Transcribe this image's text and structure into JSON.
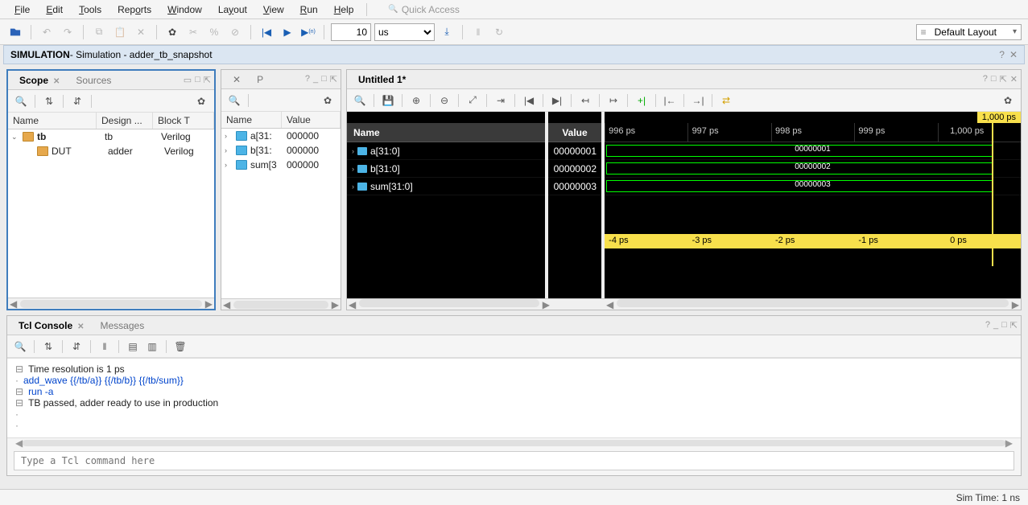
{
  "menu": {
    "items": [
      "File",
      "Edit",
      "Tools",
      "Reports",
      "Window",
      "Layout",
      "View",
      "Run",
      "Help"
    ],
    "quick_access": "Quick Access"
  },
  "toolbar": {
    "time_value": "10",
    "time_unit": "us",
    "layout": "Default Layout"
  },
  "titlebar": {
    "bold": "SIMULATION",
    "rest": " - Simulation - adder_tb_snapshot"
  },
  "scope": {
    "tab_active": "Scope",
    "tab_inactive": "Sources",
    "headers": [
      "Name",
      "Design ...",
      "Block T"
    ],
    "rows": [
      {
        "name": "tb",
        "design": "tb",
        "block": "Verilog",
        "indent": 0,
        "expanded": true
      },
      {
        "name": "DUT",
        "design": "adder",
        "block": "Verilog",
        "indent": 1,
        "expanded": false
      }
    ]
  },
  "sigpanel": {
    "tab_label": "P",
    "headers": [
      "Name",
      "Value"
    ],
    "rows": [
      {
        "name": "a[31:",
        "value": "000000"
      },
      {
        "name": "b[31:",
        "value": "000000"
      },
      {
        "name": "sum[3",
        "value": "000000"
      }
    ]
  },
  "wave": {
    "tab": "Untitled 1*",
    "name_header": "Name",
    "value_header": "Value",
    "cursor_label": "1,000 ps",
    "time_ticks": [
      "996 ps",
      "997 ps",
      "998 ps",
      "999 ps",
      "1,000 ps"
    ],
    "yellow_ticks": [
      "-4 ps",
      "-3 ps",
      "-2 ps",
      "-1 ps",
      "0 ps"
    ],
    "signals": [
      {
        "name": "a[31:0]",
        "value": "00000001",
        "bus": "00000001"
      },
      {
        "name": "b[31:0]",
        "value": "00000002",
        "bus": "00000002"
      },
      {
        "name": "sum[31:0]",
        "value": "00000003",
        "bus": "00000003"
      }
    ]
  },
  "console": {
    "tab_active": "Tcl Console",
    "tab_inactive": "Messages",
    "lines": [
      {
        "text": "Time resolution is 1 ps",
        "cls": ""
      },
      {
        "text": "add_wave {{/tb/a}} {{/tb/b}} {{/tb/sum}}",
        "cls": "blue"
      },
      {
        "text": "run -a",
        "cls": "blue"
      },
      {
        "text": "TB passed, adder ready to use in production",
        "cls": ""
      }
    ],
    "placeholder": "Type a Tcl command here"
  },
  "status": {
    "sim_time": "Sim Time: 1 ns"
  }
}
